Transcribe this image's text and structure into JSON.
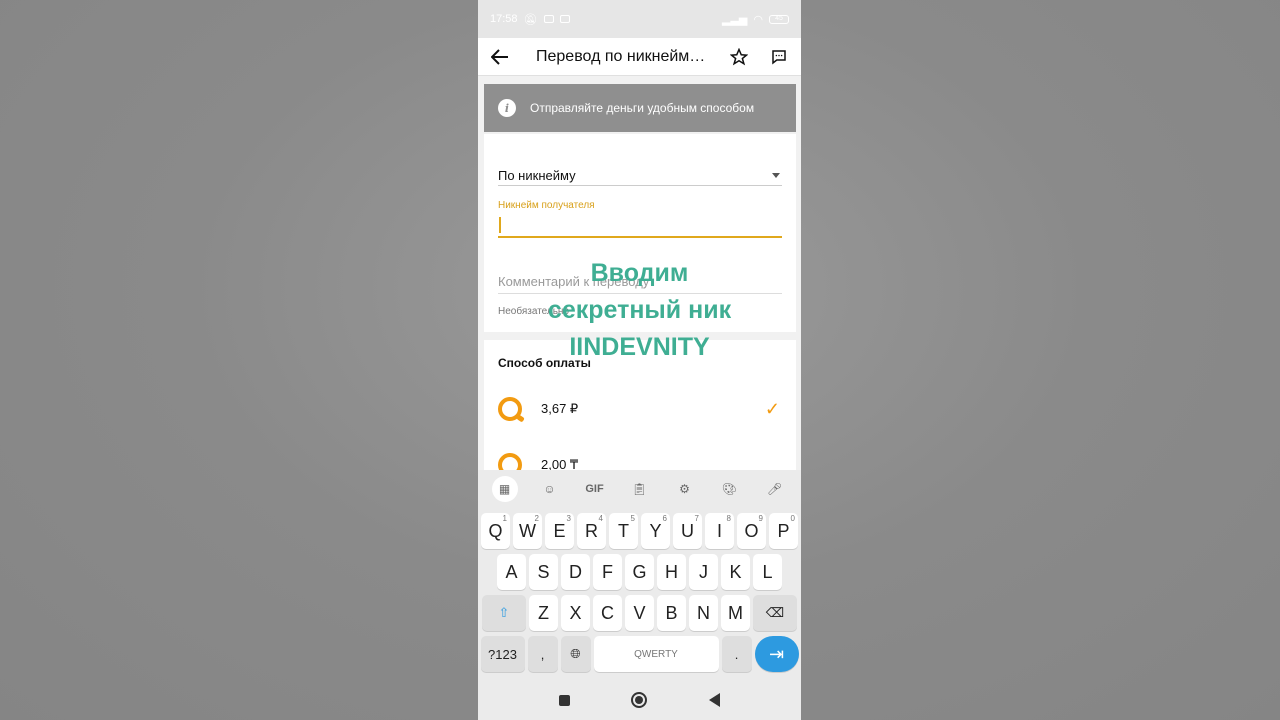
{
  "status_bar": {
    "time": "17:58",
    "battery": "45"
  },
  "app_bar": {
    "title": "Перевод по никнейм…",
    "back_icon": "arrow-left-icon",
    "favorite_icon": "star-icon",
    "chat_icon": "chat-bubble-icon"
  },
  "info_banner": {
    "text": "Отправляйте деньги удобным способом"
  },
  "form": {
    "transfer_type": "По никнейму",
    "nickname_label": "Никнейм получателя",
    "nickname_value": "",
    "comment_placeholder": "Комментарий к переводу",
    "comment_hint": "Необязательно"
  },
  "payment": {
    "title": "Способ оплаты",
    "options": [
      {
        "amount": "3,67 ₽",
        "selected": true
      },
      {
        "amount": "2,00 ₸",
        "selected": false
      }
    ]
  },
  "overlay_text": {
    "line1": "Вводим",
    "line2": "секретный ник",
    "line3": "IINDEVNITY"
  },
  "keyboard": {
    "toolbar": [
      "apps-grid-icon",
      "sticker-icon",
      "GIF",
      "clipboard-icon",
      "settings-icon",
      "palette-icon",
      "mic-icon"
    ],
    "gif_label": "GIF",
    "row1": [
      {
        "k": "Q",
        "n": "1"
      },
      {
        "k": "W",
        "n": "2"
      },
      {
        "k": "E",
        "n": "3"
      },
      {
        "k": "R",
        "n": "4"
      },
      {
        "k": "T",
        "n": "5"
      },
      {
        "k": "Y",
        "n": "6"
      },
      {
        "k": "U",
        "n": "7"
      },
      {
        "k": "I",
        "n": "8"
      },
      {
        "k": "O",
        "n": "9"
      },
      {
        "k": "P",
        "n": "0"
      }
    ],
    "row2": [
      "A",
      "S",
      "D",
      "F",
      "G",
      "H",
      "J",
      "K",
      "L"
    ],
    "row3": [
      "Z",
      "X",
      "C",
      "V",
      "B",
      "N",
      "M"
    ],
    "numbers_label": "?123",
    "space_label": "QWERTY",
    "period_label": ".",
    "comma_label": ","
  },
  "colors": {
    "accent": "#e0a81c",
    "qiwi": "#f29b11",
    "overlay": "#3fae93",
    "enter": "#2d9ae0"
  }
}
